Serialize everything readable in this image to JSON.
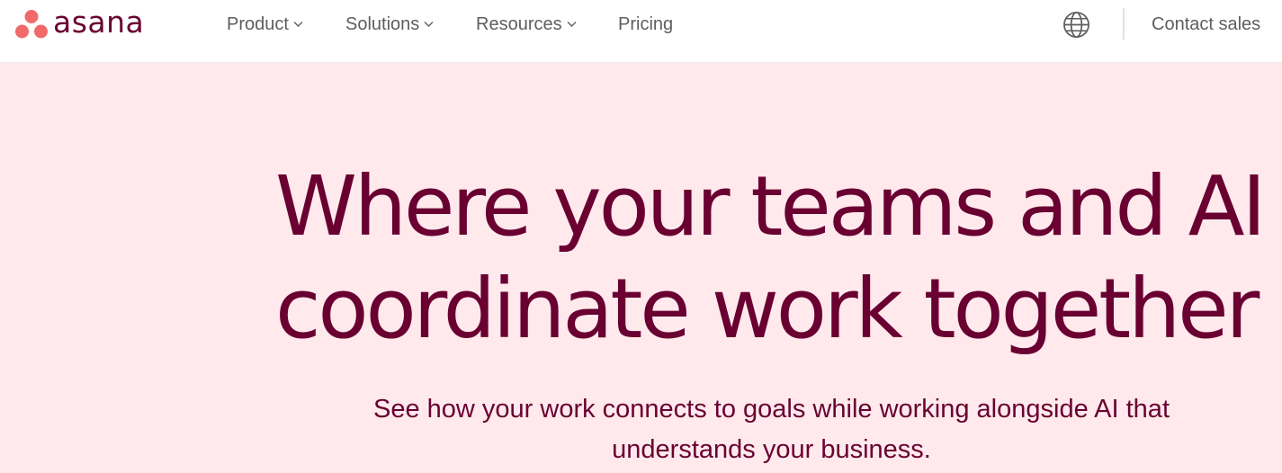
{
  "brand": {
    "name": "asana",
    "dot_color": "#f06a6a",
    "text_color": "#690031"
  },
  "nav": {
    "items": [
      {
        "label": "Product",
        "has_dropdown": true
      },
      {
        "label": "Solutions",
        "has_dropdown": true
      },
      {
        "label": "Resources",
        "has_dropdown": true
      },
      {
        "label": "Pricing",
        "has_dropdown": false
      }
    ],
    "language_icon": "globe-icon",
    "contact_label": "Contact sales"
  },
  "hero": {
    "background": "#ffe9ec",
    "title_line1": "Where your teams and AI",
    "title_line2": "coordinate work together",
    "subtitle_line1": "See how your work connects to goals while working alongside AI that",
    "subtitle_line2": "understands your business."
  }
}
